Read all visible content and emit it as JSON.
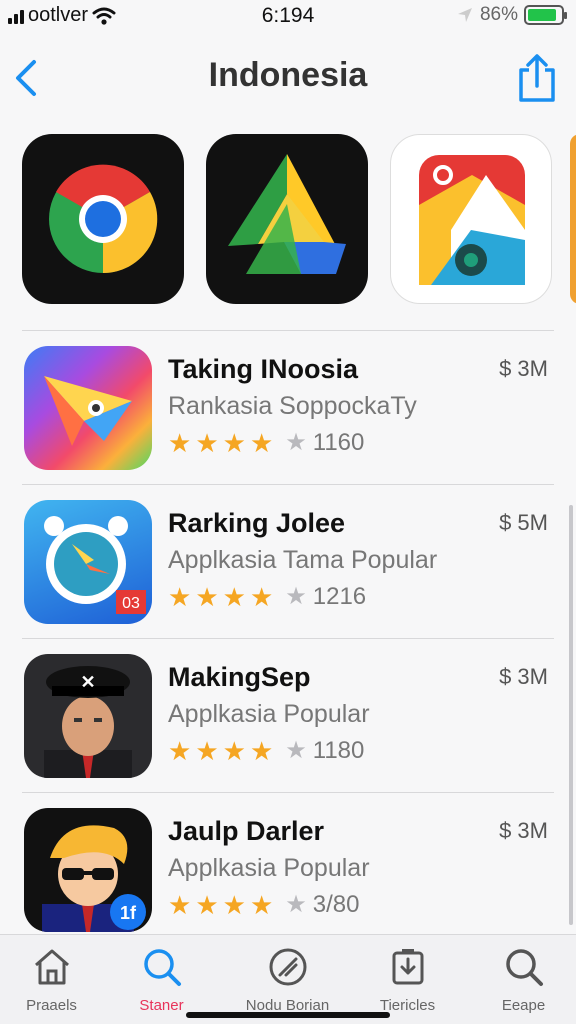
{
  "status_bar": {
    "carrier": "ootlver",
    "time": "6:194",
    "battery": "86%",
    "battery_level": 0.86,
    "icons": [
      "signal-icon",
      "wifi-icon",
      "location-icon",
      "battery-icon"
    ]
  },
  "header": {
    "title": "Indonesia",
    "back_icon": "chevron-left-icon",
    "share_icon": "share-icon"
  },
  "featured": [
    {
      "icon": "chrome-app-icon"
    },
    {
      "icon": "triangle-app-icon"
    },
    {
      "icon": "camera-app-icon"
    }
  ],
  "apps": [
    {
      "name": "Taking INoosia",
      "subtitle": "Rankasia SoppockaTy",
      "stars": 4,
      "count": "1160",
      "price": "$ 3M",
      "icon": "paper-plane-app-icon"
    },
    {
      "name": "Rarking Jolee",
      "subtitle": "Applkasia Tama Popular",
      "stars": 4,
      "count": "1216",
      "price": "$ 5M",
      "icon": "clock-app-icon",
      "badge": "03"
    },
    {
      "name": "MakingSep",
      "subtitle": "Applkasia Popular",
      "stars": 4,
      "count": "1180",
      "price": "$ 3M",
      "icon": "man-in-cap-app-icon"
    },
    {
      "name": "Jaulp Darler",
      "subtitle": "Applkasia Popular",
      "stars": 4,
      "count": "3/80",
      "price": "$ 3M",
      "icon": "cartoon-man-app-icon",
      "badge": "1f"
    }
  ],
  "tabs": [
    {
      "label": "Praaels",
      "icon": "home-icon",
      "active": false
    },
    {
      "label": "Staner",
      "icon": "search-icon",
      "active": true
    },
    {
      "label": "Nodu Borian",
      "icon": "compass-icon",
      "active": false
    },
    {
      "label": "Tiericles",
      "icon": "download-icon",
      "active": false
    },
    {
      "label": "Eeape",
      "icon": "search-icon",
      "active": false
    }
  ],
  "colors": {
    "accent": "#1a8ff0",
    "star": "#f5a623",
    "active_tab": "#e8335a",
    "battery": "#22c34a"
  }
}
